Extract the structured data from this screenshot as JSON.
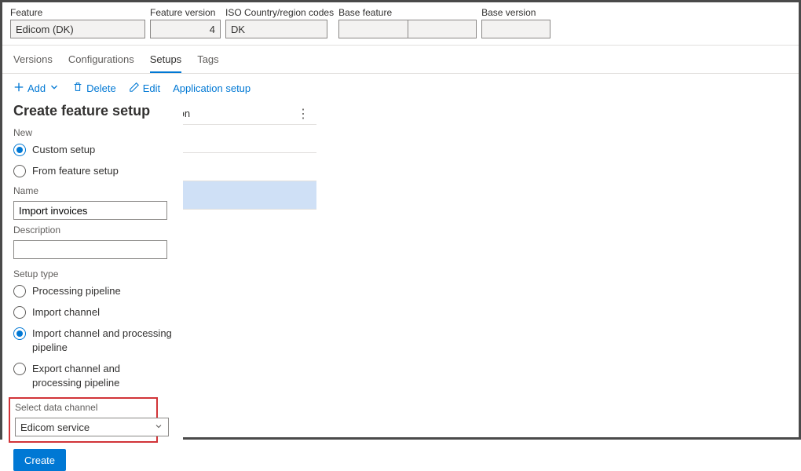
{
  "header": {
    "feature_label": "Feature",
    "feature_value": "Edicom (DK)",
    "version_label": "Feature version",
    "version_value": "4",
    "iso_label": "ISO Country/region codes",
    "iso_value": "DK",
    "base_feature_label": "Base feature",
    "base_feature_value": "",
    "base_version_label": "Base version",
    "base_version_value": ""
  },
  "tabs": {
    "versions": "Versions",
    "configurations": "Configurations",
    "setups": "Setups",
    "tags": "Tags"
  },
  "toolbar": {
    "add": "Add",
    "delete": "Delete",
    "edit": "Edit",
    "app_setup": "Application setup"
  },
  "grid": {
    "col_description": "iption"
  },
  "panel": {
    "title": "Create feature setup",
    "new_label": "New",
    "radio_custom": "Custom setup",
    "radio_from_feature": "From feature setup",
    "name_label": "Name",
    "name_value": "Import invoices",
    "description_label": "Description",
    "description_value": "",
    "setup_type_label": "Setup type",
    "radio_processing": "Processing pipeline",
    "radio_import_channel": "Import channel",
    "radio_import_pipeline": "Import channel and processing pipeline",
    "radio_export_pipeline": "Export channel and processing pipeline",
    "select_channel_label": "Select data channel",
    "select_channel_value": "Edicom service",
    "create_btn": "Create"
  }
}
